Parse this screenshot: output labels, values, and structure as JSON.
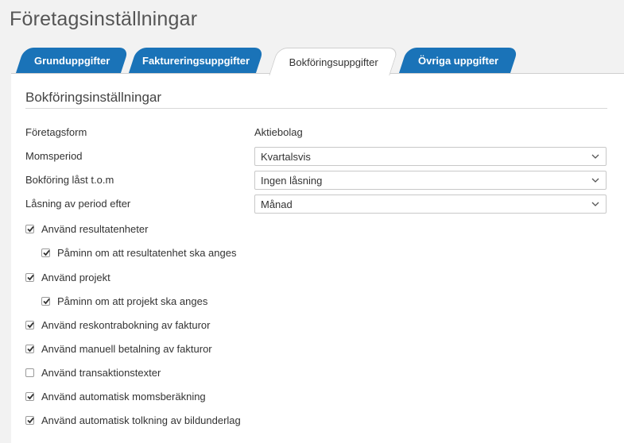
{
  "page": {
    "title": "Företagsinställningar"
  },
  "tabs": [
    {
      "label": "Grunduppgifter",
      "active": false
    },
    {
      "label": "Faktureringsuppgifter",
      "active": false
    },
    {
      "label": "Bokföringsuppgifter",
      "active": true
    },
    {
      "label": "Övriga uppgifter",
      "active": false
    }
  ],
  "section": {
    "title": "Bokföringsinställningar"
  },
  "fields": {
    "company_form": {
      "label": "Företagsform",
      "value": "Aktiebolag"
    },
    "vat_period": {
      "label": "Momsperiod",
      "value": "Kvartalsvis"
    },
    "locked_until": {
      "label": "Bokföring låst t.o.m",
      "value": "Ingen låsning"
    },
    "lock_after": {
      "label": "Låsning av period efter",
      "value": "Månad"
    }
  },
  "checkboxes": [
    {
      "label": "Använd resultatenheter",
      "checked": true
    },
    {
      "label": "Påminn om att resultatenhet ska anges",
      "checked": true
    },
    {
      "label": "Använd projekt",
      "checked": true
    },
    {
      "label": "Påminn om att projekt ska anges",
      "checked": true
    },
    {
      "label": "Använd reskontrabokning av fakturor",
      "checked": true
    },
    {
      "label": "Använd manuell betalning av fakturor",
      "checked": true
    },
    {
      "label": "Använd transaktionstexter",
      "checked": false
    },
    {
      "label": "Använd automatisk momsberäkning",
      "checked": true
    },
    {
      "label": "Använd automatisk tolkning av bildunderlag",
      "checked": true
    }
  ],
  "colors": {
    "tab_blue": "#1a73b8",
    "panel_bg": "#ffffff",
    "page_bg": "#f2f2f2"
  }
}
